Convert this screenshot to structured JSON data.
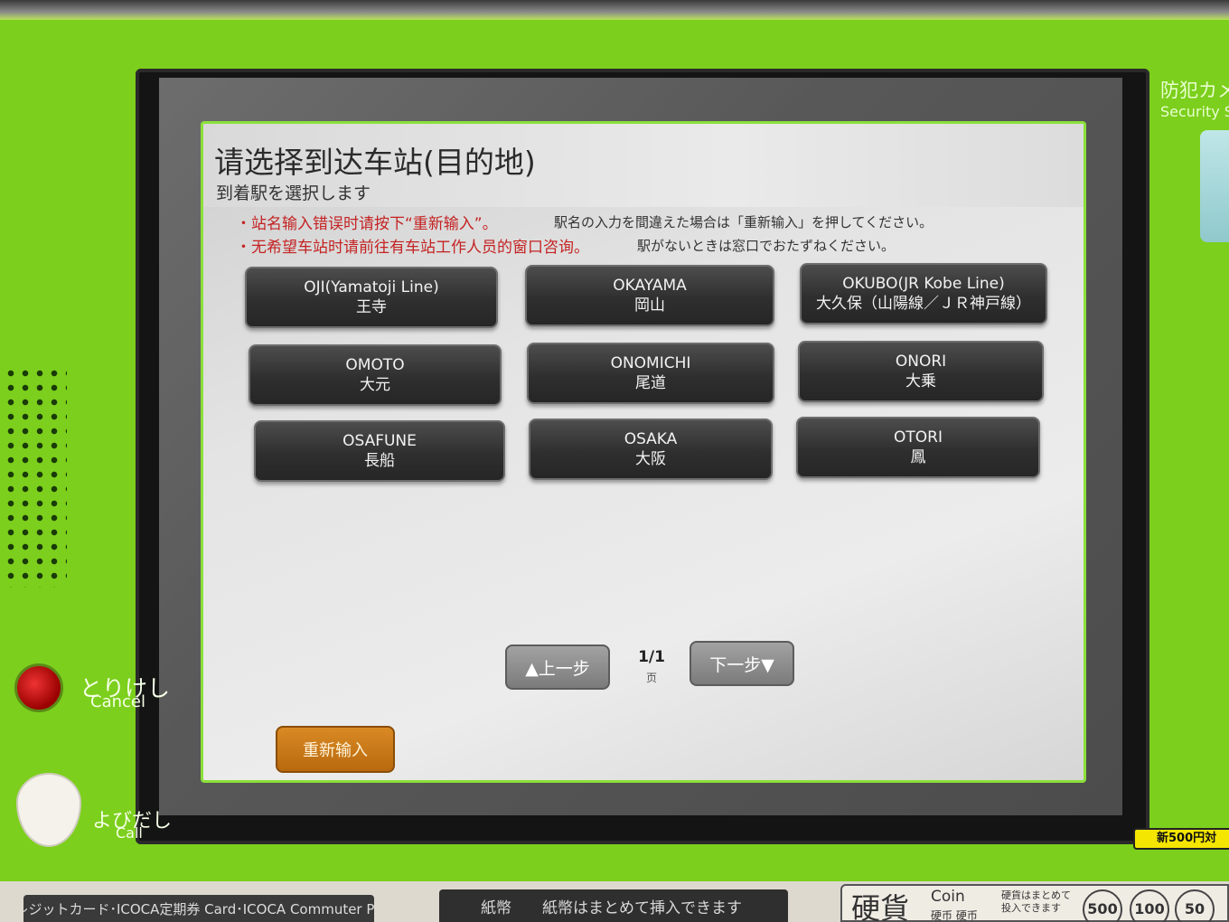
{
  "screen": {
    "title_zh": "请选择到达车站(目的地)",
    "title_ja": "到着駅を選択します",
    "notices": [
      {
        "zh": "・站名输入错误时请按下“重新输入”。",
        "ja": "駅名の入力を間違えた場合は「重新输入」を押してください。"
      },
      {
        "zh": "・无希望车站时请前往有车站工作人员的窗口咨询。",
        "ja": "駅がないときは窓口でおたずねください。"
      }
    ],
    "stations": [
      {
        "en": "OJI(Yamatoji Line)",
        "jp": "王寺"
      },
      {
        "en": "OKAYAMA",
        "jp": "岡山"
      },
      {
        "en": "OKUBO(JR Kobe Line)",
        "jp": "大久保（山陽線／ＪＲ神戸線）"
      },
      {
        "en": "OMOTO",
        "jp": "大元"
      },
      {
        "en": "ONOMICHI",
        "jp": "尾道"
      },
      {
        "en": "ONORI",
        "jp": "大乗"
      },
      {
        "en": "OSAFUNE",
        "jp": "長船"
      },
      {
        "en": "OSAKA",
        "jp": "大阪"
      },
      {
        "en": "OTORI",
        "jp": "鳳"
      }
    ],
    "prev_label": "▲上一步",
    "next_label": "下一步▼",
    "page": "1/1",
    "page_unit": "页",
    "reinput_label": "重新输入"
  },
  "machine": {
    "cancel_ja": "とりけし",
    "cancel_en": "Cancel",
    "call_ja": "よびだし",
    "call_en": "Call",
    "security_ja": "防犯カメ",
    "security_en": "Security Sy",
    "badge": "新500円対",
    "card_slot": "クレジットカード･ICOCA定期券 Card･ICOCA Commuter Pass",
    "bill_slot": "紙幣　　紙幣はまとめて挿入できます",
    "coin_kanji": "硬貨",
    "coin_en": "Coin",
    "coin_sub": "硬币 硬币",
    "coin_note": "硬貨はまとめて\n投入できます",
    "coins": [
      "500",
      "100",
      "50"
    ]
  },
  "colors": {
    "machine_green": "#7ccf1c",
    "button_dark": "#2f2f2f",
    "notice_red": "#c42222",
    "reinput_orange": "#d98a24"
  }
}
